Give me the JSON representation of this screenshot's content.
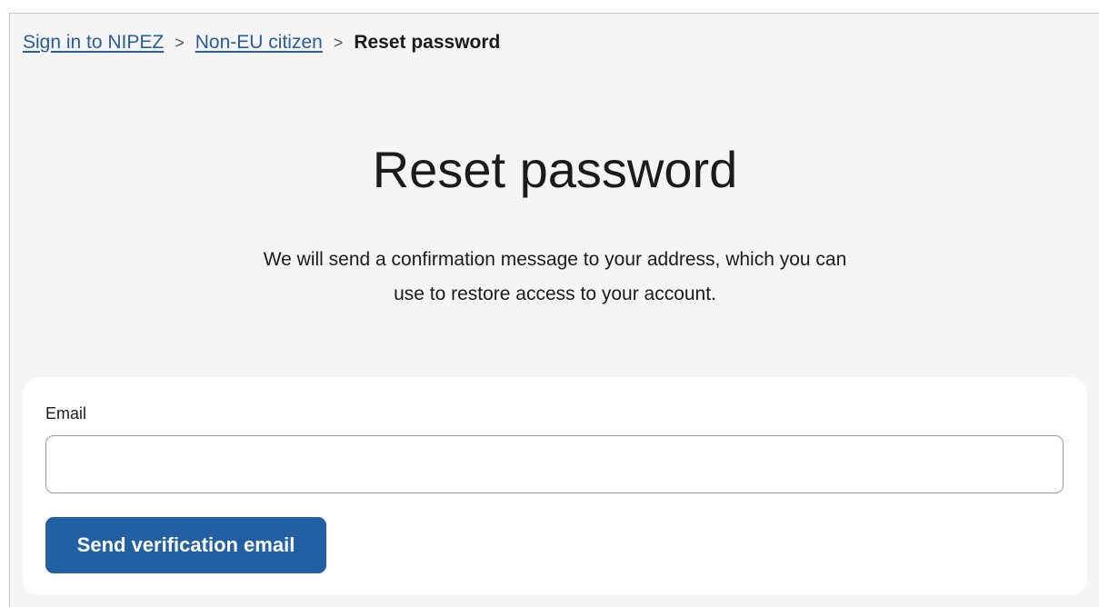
{
  "breadcrumb": {
    "items": [
      {
        "label": "Sign in to NIPEZ"
      },
      {
        "label": "Non-EU citizen"
      }
    ],
    "separator": ">",
    "current": "Reset password"
  },
  "page": {
    "title": "Reset password",
    "description_lines": [
      "We will send a confirmation message to your address, which you can",
      "use to restore access to your account."
    ]
  },
  "form": {
    "email_label": "Email",
    "email_value": "",
    "email_placeholder": "",
    "submit_label": "Send verification email"
  },
  "colors": {
    "page_background": "#f5f5f5",
    "card_background": "#ffffff",
    "link": "#2a5d95",
    "primary_button": "#2260a4",
    "text": "#1b1b1b"
  }
}
